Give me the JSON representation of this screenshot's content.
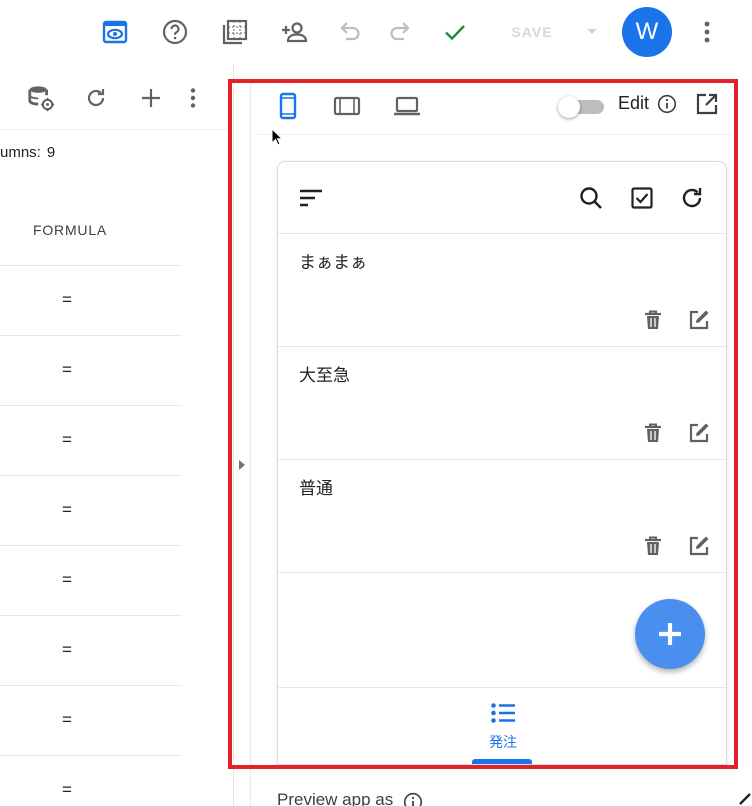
{
  "toolbar": {
    "preview_icon": "eye-icon",
    "help_icon": "help-circle-icon",
    "sheets_icon": "grid-frame-icon",
    "share_icon": "add-person-icon",
    "undo_icon": "undo-icon",
    "redo_icon": "redo-icon",
    "check_icon": "check-icon",
    "save_label": "SAVE",
    "avatar_letter": "W",
    "more_icon": "more-vertical-icon",
    "accent": "#1a73e8",
    "check_color": "#1e8e3e"
  },
  "left_panel": {
    "icons": [
      "database-settings-icon",
      "refresh-icon",
      "plus-icon",
      "more-vertical-icon"
    ],
    "columns_label": "umns:",
    "columns_count": "9",
    "formula_header": "FORMULA",
    "rows": [
      "=",
      "=",
      "=",
      "=",
      "=",
      "=",
      "=",
      "="
    ]
  },
  "preview": {
    "device_icons": [
      "phone-icon",
      "tablet-icon",
      "laptop-icon"
    ],
    "edit_label": "Edit",
    "edit_toggle_on": false,
    "preview_as_label": "Preview app as",
    "highlight_color": "#e3212b"
  },
  "app": {
    "header_icons": [
      "sort-lines-icon",
      "search-icon",
      "checkbox-icon",
      "refresh-icon"
    ],
    "cards": [
      {
        "title": "まぁまぁ"
      },
      {
        "title": "大至急"
      },
      {
        "title": "普通"
      }
    ],
    "fab_icon": "plus-icon",
    "nav_label": "発注",
    "nav_icon": "list-icon",
    "fab_color": "#4a8ff0"
  }
}
